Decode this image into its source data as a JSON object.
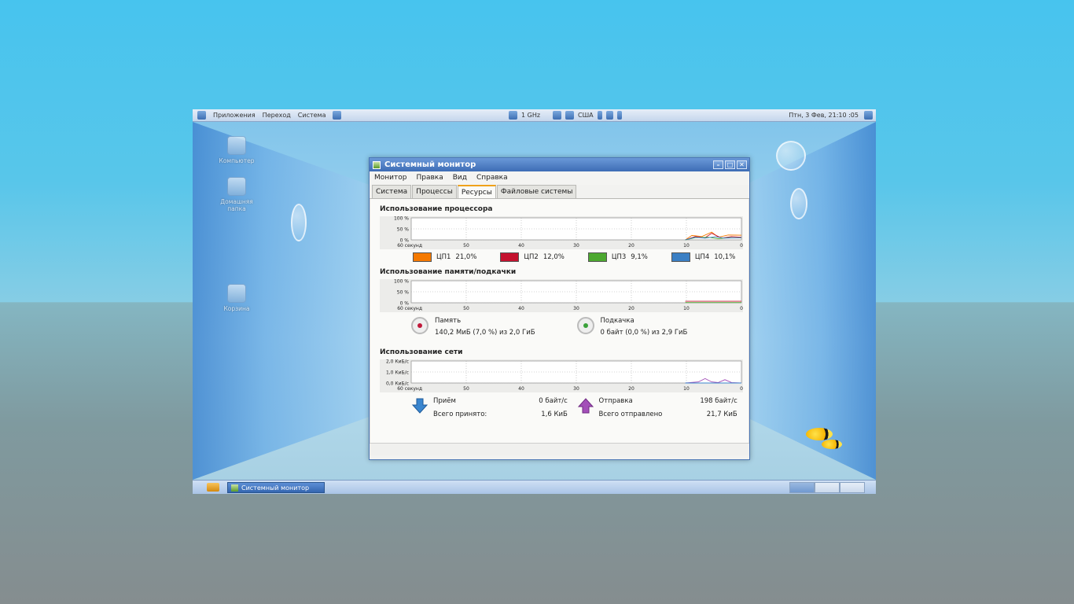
{
  "top_panel": {
    "menu": [
      "Приложения",
      "Переход",
      "Система"
    ],
    "cpu_freq": "1 GHz",
    "keyboard_layout": "США",
    "clock": "Птн, 3 Фев, 21:10 :05"
  },
  "desktop_icons": [
    "Компьютер",
    "Домашняя папка",
    "Корзина"
  ],
  "window": {
    "title": "Системный монитор",
    "menu": [
      "Монитор",
      "Правка",
      "Вид",
      "Справка"
    ],
    "tabs": [
      "Система",
      "Процессы",
      "Ресурсы",
      "Файловые системы"
    ],
    "active_tab": "Ресурсы",
    "cpu": {
      "title": "Использование процессора",
      "y_ticks": [
        "100 %",
        "50 %",
        "0 %"
      ],
      "x_ticks": [
        "60 секунд",
        "50",
        "40",
        "30",
        "20",
        "10",
        "0"
      ],
      "legend": [
        {
          "label": "ЦП1",
          "value": "21,0%",
          "color": "#f57900"
        },
        {
          "label": "ЦП2",
          "value": "12,0%",
          "color": "#c4122f"
        },
        {
          "label": "ЦП3",
          "value": "9,1%",
          "color": "#4ca830"
        },
        {
          "label": "ЦП4",
          "value": "10,1%",
          "color": "#3b7fc4"
        }
      ]
    },
    "memory": {
      "title": "Использование памяти/подкачки",
      "y_ticks": [
        "100 %",
        "50 %",
        "0 %"
      ],
      "x_ticks": [
        "60 секунд",
        "50",
        "40",
        "30",
        "20",
        "10",
        "0"
      ],
      "mem_label": "Память",
      "mem_value": "140,2 МиБ (7,0 %) из 2,0 ГиБ",
      "swap_label": "Подкачка",
      "swap_value": "0 байт (0,0 %) из 2,9 ГиБ"
    },
    "network": {
      "title": "Использование сети",
      "y_ticks": [
        "2,0 КиБ/с",
        "1,0 КиБ/с",
        "0,0 КиБ/с"
      ],
      "x_ticks": [
        "60 секунд",
        "50",
        "40",
        "30",
        "20",
        "10",
        "0"
      ],
      "recv_label": "Приём",
      "recv_rate": "0 байт/с",
      "recv_total_label": "Всего принято:",
      "recv_total": "1,6 КиБ",
      "send_label": "Отправка",
      "send_rate": "198 байт/с",
      "send_total_label": "Всего отправлено",
      "send_total": "21,7 КиБ"
    }
  },
  "taskbar": {
    "task_label": "Системный монитор"
  }
}
